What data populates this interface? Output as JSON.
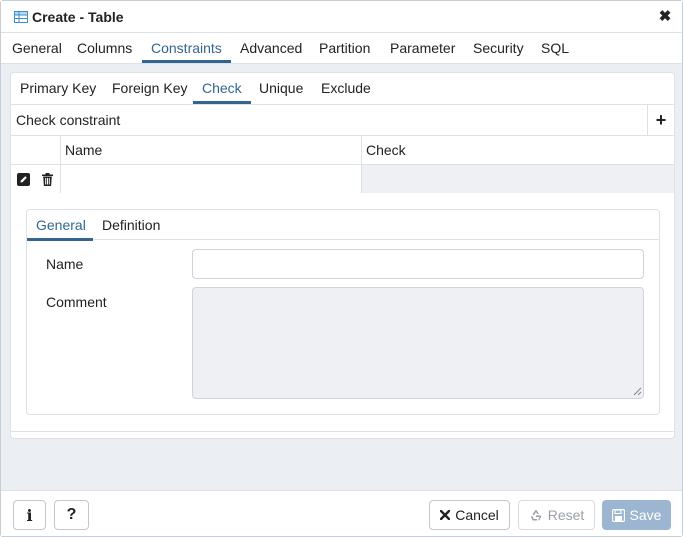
{
  "dialog": {
    "title": "Create - Table",
    "close_glyph": "✖"
  },
  "main_tabs": [
    {
      "label": "General"
    },
    {
      "label": "Columns"
    },
    {
      "label": "Constraints",
      "active": true
    },
    {
      "label": "Advanced"
    },
    {
      "label": "Partition"
    },
    {
      "label": "Parameter"
    },
    {
      "label": "Security"
    },
    {
      "label": "SQL"
    }
  ],
  "constraint_tabs": [
    {
      "label": "Primary Key"
    },
    {
      "label": "Foreign Key"
    },
    {
      "label": "Check",
      "active": true
    },
    {
      "label": "Unique"
    },
    {
      "label": "Exclude"
    }
  ],
  "check_constraint": {
    "section_title": "Check constraint",
    "add_glyph": "+",
    "columns": [
      "Name",
      "Check"
    ],
    "rows": [
      {
        "name": "",
        "check": ""
      }
    ]
  },
  "detail_tabs": [
    {
      "label": "General",
      "active": true
    },
    {
      "label": "Definition"
    }
  ],
  "form": {
    "name_label": "Name",
    "name_value": "",
    "comment_label": "Comment",
    "comment_value": ""
  },
  "footer": {
    "info_glyph": "i",
    "help_glyph": "?",
    "cancel_label": "Cancel",
    "reset_label": "Reset",
    "save_label": "Save"
  },
  "colors": {
    "accent": "#326690",
    "save_disabled_bg": "#9cb5d0",
    "readonly_bg": "#eef0f3",
    "dialog_bg": "#ebeef3"
  }
}
